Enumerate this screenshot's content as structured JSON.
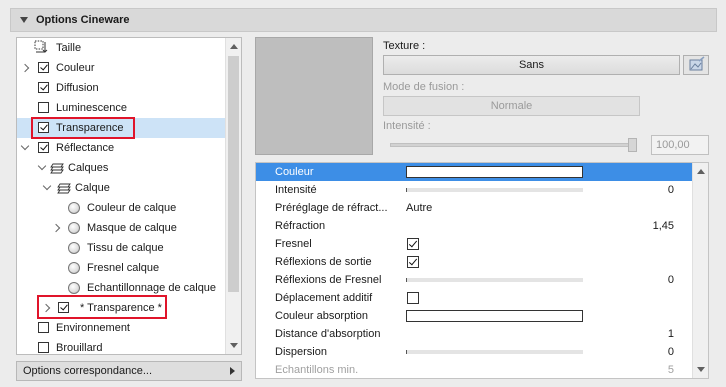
{
  "panel": {
    "title": "Options Cineware"
  },
  "tree": {
    "items": [
      {
        "label": "Taille",
        "checkbox": "none",
        "icon": "size-icon"
      },
      {
        "label": "Couleur",
        "checkbox": "checked",
        "expander": "collapsed"
      },
      {
        "label": "Diffusion",
        "checkbox": "checked"
      },
      {
        "label": "Luminescence",
        "checkbox": "unchecked"
      },
      {
        "label": "Transparence",
        "checkbox": "checked",
        "selected": true
      },
      {
        "label": "Réflectance",
        "checkbox": "checked",
        "expander": "expanded"
      },
      {
        "label": "Calques",
        "icon": "layers-icon",
        "expander": "expanded"
      },
      {
        "label": "Calque",
        "icon": "layers-icon",
        "expander": "expanded"
      },
      {
        "label": "Couleur de calque",
        "icon": "radio-icon"
      },
      {
        "label": "Masque de calque",
        "icon": "radio-icon",
        "expander": "collapsed"
      },
      {
        "label": "Tissu de calque",
        "icon": "radio-icon"
      },
      {
        "label": "Fresnel calque",
        "icon": "radio-icon"
      },
      {
        "label": "Echantillonnage de calque",
        "icon": "radio-icon"
      },
      {
        "label": "* Transparence *",
        "checkbox": "checked",
        "expander": "collapsed"
      },
      {
        "label": "Environnement",
        "checkbox": "unchecked"
      },
      {
        "label": "Brouillard",
        "checkbox": "unchecked"
      }
    ]
  },
  "footer": {
    "options_button": "Options correspondance..."
  },
  "texture": {
    "label": "Texture :",
    "value": "Sans",
    "blend_label": "Mode de fusion :",
    "blend_value": "Normale",
    "intensity_label": "Intensité :",
    "intensity_value": "100,00",
    "intensity_fraction": 1.0
  },
  "properties": [
    {
      "label": "Couleur",
      "type": "color",
      "selected": true
    },
    {
      "label": "Intensité",
      "type": "bar",
      "value": "0"
    },
    {
      "label": "Préréglage de réfract...",
      "type": "text",
      "value": "Autre"
    },
    {
      "label": "Réfraction",
      "type": "number",
      "value": "1,45"
    },
    {
      "label": "Fresnel",
      "type": "checkbox",
      "checked": true
    },
    {
      "label": "Réflexions de sortie",
      "type": "checkbox",
      "checked": true
    },
    {
      "label": "Réflexions de Fresnel",
      "type": "bar",
      "value": "0"
    },
    {
      "label": "Déplacement additif",
      "type": "checkbox",
      "checked": false
    },
    {
      "label": "Couleur absorption",
      "type": "color"
    },
    {
      "label": "Distance d'absorption",
      "type": "number",
      "value": "1"
    },
    {
      "label": "Dispersion",
      "type": "bar",
      "value": "0"
    },
    {
      "label": "Echantillons min.",
      "type": "number",
      "value": "5",
      "disabled": true
    }
  ],
  "colors": {
    "selection": "#3d8ee6",
    "tree_selection": "#cde3f7",
    "highlight": "#e0142a"
  }
}
